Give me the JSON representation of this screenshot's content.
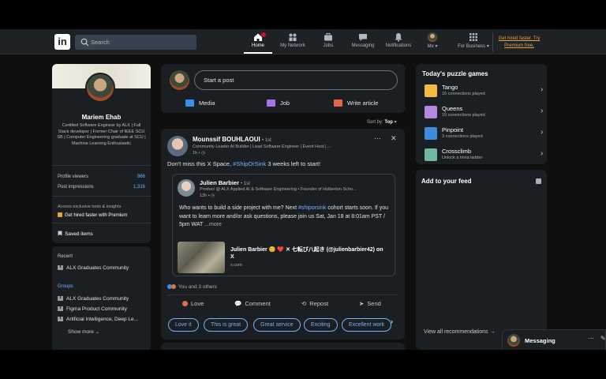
{
  "nav": {
    "search_placeholder": "Search",
    "items": [
      {
        "label": "Home",
        "icon": "home-icon"
      },
      {
        "label": "My Network",
        "icon": "network-icon"
      },
      {
        "label": "Jobs",
        "icon": "briefcase-icon"
      },
      {
        "label": "Messaging",
        "icon": "chat-icon"
      },
      {
        "label": "Notifications",
        "icon": "bell-icon"
      },
      {
        "label": "Me",
        "icon": "avatar"
      },
      {
        "label": "For Business",
        "icon": "grid-icon"
      }
    ],
    "premium_line1": "Get hired faster. Try",
    "premium_line2": "Premium free."
  },
  "profile": {
    "name": "Mariem Ehab",
    "headline": "Certified Software Engineer by ALX | Full Stack developer | Former Chair of IEEE SCU SB | Computer Engineering graduate at SCU | Machine Learning Enthusiastic",
    "stats": [
      {
        "label": "Profile viewers",
        "value": "866"
      },
      {
        "label": "Post impressions",
        "value": "1,316"
      }
    ],
    "premium_prompt": "Access exclusive tools & insights",
    "premium_cta": "Get hired faster with Premium",
    "saved_items": "Saved items"
  },
  "sidebar": {
    "recent_title": "Recent",
    "recent": [
      "ALX Graduates Community"
    ],
    "groups_title": "Groups",
    "groups": [
      "ALX Graduates Community",
      "Figma Product Community",
      "Artificial Intelligence, Deep Le..."
    ],
    "show_more": "Show more"
  },
  "composer": {
    "placeholder": "Start a post",
    "actions": [
      {
        "label": "Media",
        "color": "#378fe9"
      },
      {
        "label": "Job",
        "color": "#a872e8"
      },
      {
        "label": "Write article",
        "color": "#e06847"
      }
    ]
  },
  "sort": {
    "label": "Sort by:",
    "value": "Top"
  },
  "post": {
    "author": "Mounssif BOUHLAOUI",
    "degree": "• 1st",
    "subtitle": "Community Leader AI Builder | Lead Software Engineer | Event Host | ...",
    "time": "1h • ◷",
    "text_prefix": "Don't miss this X Space, ",
    "text_tag": "#ShipOrSink",
    "text_suffix": " 3 weeks left to start!",
    "shared": {
      "author": "Julien Barbier",
      "degree": "• 1st",
      "subtitle": "Product @ ALX Applied AI & Software Engineering • Founder of Holberton Scho...",
      "time": "13h • ◷",
      "text_1": "Who wants to build a side project with me? Next ",
      "text_tag": "#shiporsink",
      "text_2": " cohort starts soon. If you want to learn more and/or ask questions, please join us Sat, Jan 18 at 8:01am PST / 5pm WAT",
      "more": " ...more",
      "link_title": "Julien Barbier 😊 ❤️ ✕ 七転び八起き (@julienbarbier42) on X",
      "link_url": "x.com"
    },
    "reactions": "You and 3 others",
    "actions": [
      "Love",
      "Comment",
      "Repost",
      "Send"
    ],
    "pills": [
      "Love it",
      "This is great",
      "Great service",
      "Exciting",
      "Excellent work"
    ]
  },
  "puzzles": {
    "title": "Today's puzzle games",
    "games": [
      {
        "name": "Tango",
        "sub": "15 connections played",
        "color": "#f5b942"
      },
      {
        "name": "Queens",
        "sub": "19 connections played",
        "color": "#b389e0"
      },
      {
        "name": "Pinpoint",
        "sub": "3 connections played",
        "color": "#3d8bd9"
      },
      {
        "name": "Crossclimb",
        "sub": "Unlock a trivia ladder",
        "color": "#6fb7a0"
      }
    ]
  },
  "feed_add": {
    "title": "Add to your feed",
    "view_all": "View all recommendations →"
  },
  "messaging": {
    "label": "Messaging"
  }
}
